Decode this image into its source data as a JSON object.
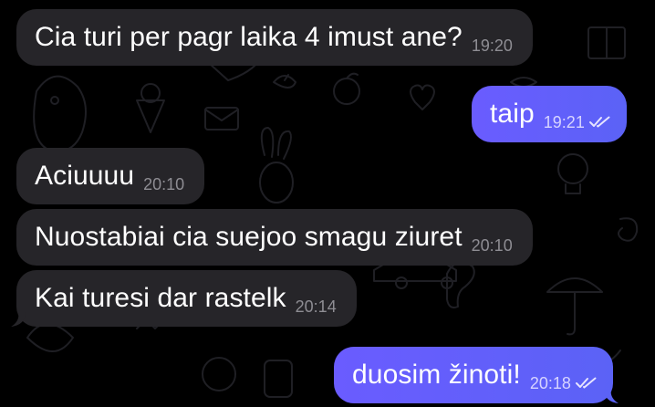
{
  "conversation": {
    "messages": [
      {
        "direction": "incoming",
        "text": "Cia turi per pagr laika 4 imust ane?",
        "time": "19:20",
        "read": false
      },
      {
        "direction": "outgoing",
        "text": "taip",
        "time": "19:21",
        "read": true
      },
      {
        "direction": "incoming",
        "text": "Aciuuuu",
        "time": "20:10",
        "read": false
      },
      {
        "direction": "incoming",
        "text": "Nuostabiai cia suejoo smagu ziuret",
        "time": "20:10",
        "read": false
      },
      {
        "direction": "incoming",
        "text": "Kai turesi dar rastelk",
        "time": "20:14",
        "read": false
      },
      {
        "direction": "outgoing",
        "text": "duosim žinoti!",
        "time": "20:18",
        "read": true
      }
    ]
  },
  "icons": {
    "read_receipt": "double-check-icon",
    "wallpaper": "doodle-pattern"
  },
  "colors": {
    "background": "#000000",
    "incoming_bubble": "#262529",
    "outgoing_bubble": "#6a5cff",
    "incoming_time": "#8e8d93",
    "outgoing_time": "#d7d4ff",
    "doodle_stroke": "#1f1f24"
  }
}
